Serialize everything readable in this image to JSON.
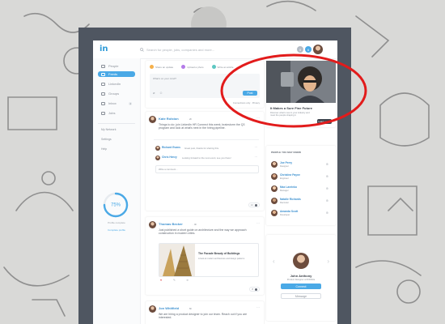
{
  "brand": {
    "logo": "in",
    "accent": "#2f9bd8",
    "annotation_color": "#e21b1b"
  },
  "search": {
    "placeholder": "Search for people, jobs, companies and more..."
  },
  "top_icons": [
    {
      "name": "bell-icon",
      "count": "5"
    },
    {
      "name": "message-icon",
      "count": "6"
    }
  ],
  "sidebar": {
    "items": [
      {
        "label": "People",
        "badge": ""
      },
      {
        "label": "Feeds",
        "badge": ""
      },
      {
        "label": "LinkedIn",
        "badge": ""
      },
      {
        "label": "Groups",
        "badge": ""
      },
      {
        "label": "Inbox",
        "badge": "4"
      },
      {
        "label": "Jobs",
        "badge": ""
      }
    ],
    "links": [
      "My Network",
      "Settings",
      "Help"
    ],
    "profile": {
      "percent": "75%",
      "caption": "Profile complete",
      "link": "Complete profile"
    }
  },
  "composer": {
    "tabs": [
      {
        "label": "Share an update"
      },
      {
        "label": "Upload a photo"
      },
      {
        "label": "Write an article"
      }
    ],
    "placeholder": "What's on your mind?",
    "post_label": "Post",
    "footer_note": "Connections only · Privacy"
  },
  "posts": [
    {
      "author": "Kate Rolston",
      "meta": "· 2h",
      "text": "Things to do: join LinkedIn HR Connect this week, brainstorm the Q3 program and look at what's next in the hiring pipeline.",
      "comments": [
        {
          "author": "Richard Evans",
          "text": "Great post, thanks for sharing this."
        },
        {
          "author": "Chris Henry",
          "text": "Looking forward to the next event, see you there!"
        }
      ],
      "comment_placeholder": "Write a comment...",
      "count": "12"
    },
    {
      "author": "Thomas Becker",
      "meta": "· 4h",
      "text": "Just published a short guide on architecture and the way we approach construction in modern cities.",
      "link": {
        "title": "The Facade Beauty of Buildings",
        "desc": "A look at modern architecture and design patterns"
      },
      "count": "8"
    },
    {
      "author": "Jon Whitfield",
      "meta": "· 6h",
      "text": "We are hiring a product designer to join our team. Reach out if you are interested."
    }
  ],
  "promo": {
    "title": "It Makes a Sure Fine Future",
    "text": "Discover what's new in your industry and meet the people shaping it.",
    "button": "Learn more"
  },
  "suggestions": {
    "title": "PEOPLE YOU MAY KNOW",
    "people": [
      {
        "name": "Joe Perry",
        "role": "Designer"
      },
      {
        "name": "Christine Payne",
        "role": "Engineer"
      },
      {
        "name": "Max Lavrinko",
        "role": "Manager"
      },
      {
        "name": "Natalie Richards",
        "role": "Recruiter"
      },
      {
        "name": "Amanda Scott",
        "role": "Developer"
      }
    ]
  },
  "profile_card": {
    "name": "John Anthony",
    "role": "Product Designer at Dribbble",
    "connect": "Connect",
    "message": "Message"
  }
}
